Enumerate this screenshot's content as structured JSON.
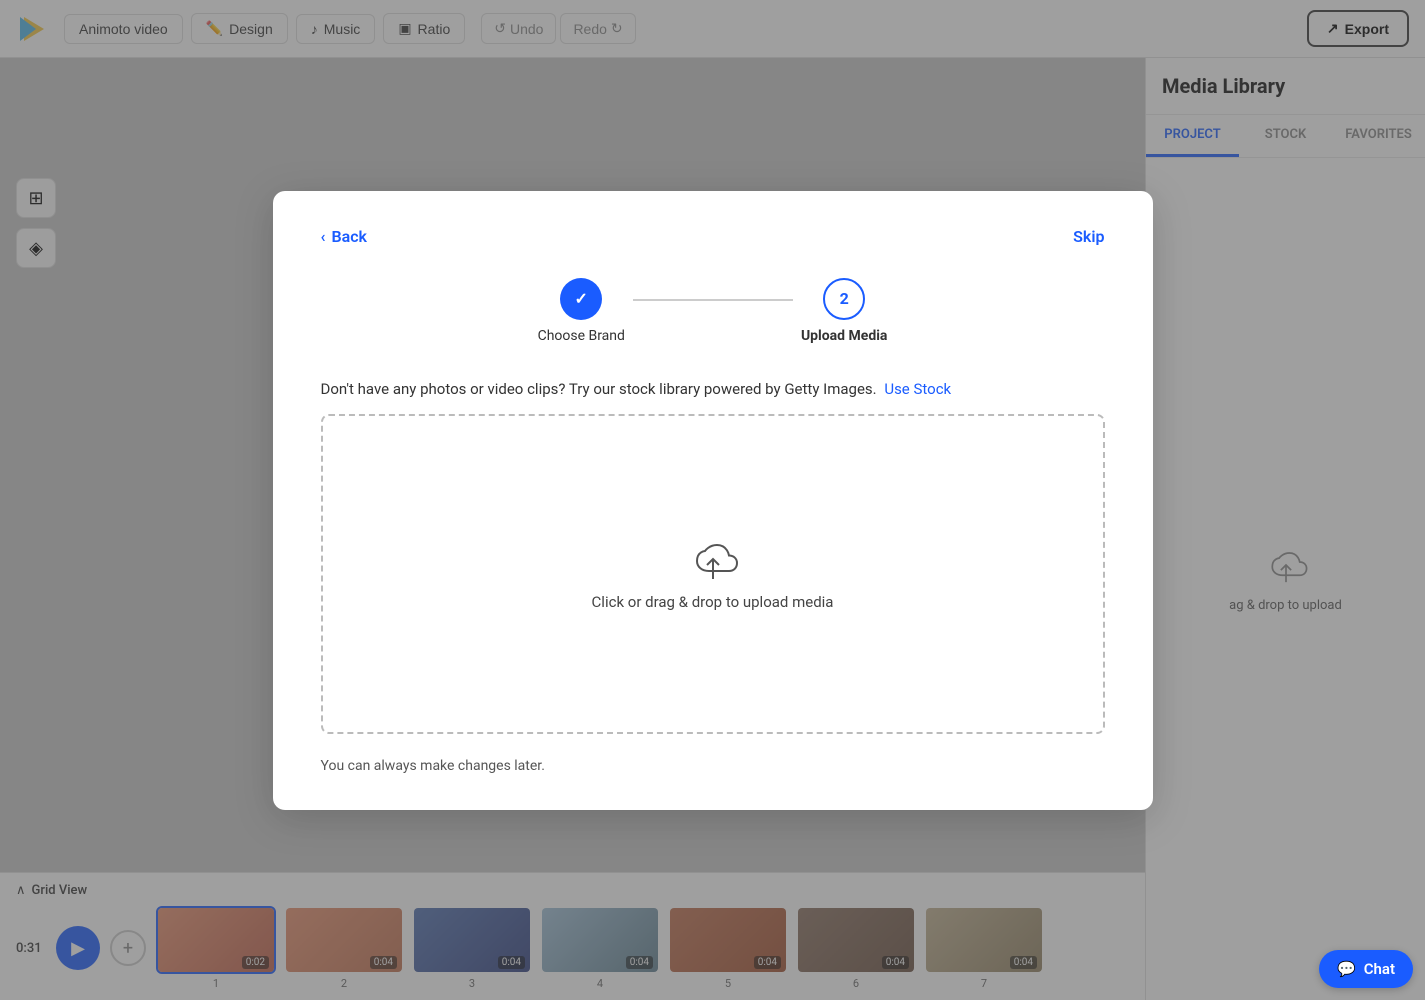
{
  "toolbar": {
    "logo_alt": "Animoto logo",
    "project_label": "Animoto video",
    "design_label": "Design",
    "music_label": "Music",
    "ratio_label": "Ratio",
    "undo_label": "Undo",
    "redo_label": "Redo",
    "export_label": "Export"
  },
  "right_panel": {
    "title": "Media Library",
    "tabs": [
      "PROJECT",
      "STOCK",
      "FAVORITES"
    ],
    "active_tab": 0,
    "upload_text": "ag & drop to upload"
  },
  "bottom": {
    "grid_view_label": "Grid View",
    "time": "0:31",
    "clips": [
      {
        "num": "1",
        "duration": "0:02",
        "selected": true,
        "thumb_class": "thumb-1"
      },
      {
        "num": "2",
        "duration": "0:04",
        "selected": false,
        "thumb_class": "thumb-2"
      },
      {
        "num": "3",
        "duration": "0:04",
        "selected": false,
        "thumb_class": "thumb-3"
      },
      {
        "num": "4",
        "duration": "0:04",
        "selected": false,
        "thumb_class": "thumb-4"
      },
      {
        "num": "5",
        "duration": "0:04",
        "selected": false,
        "thumb_class": "thumb-5"
      },
      {
        "num": "6",
        "duration": "0:04",
        "selected": false,
        "thumb_class": "thumb-6"
      },
      {
        "num": "7",
        "duration": "0:04",
        "selected": false,
        "thumb_class": "thumb-7"
      }
    ]
  },
  "modal": {
    "back_label": "Back",
    "skip_label": "Skip",
    "step1_label": "Choose Brand",
    "step2_label": "Upload Media",
    "step2_num": "2",
    "upload_desc_text": "Don't have any photos or video clips? Try our stock library powered by Getty Images.",
    "use_stock_label": "Use Stock",
    "drop_label": "Click or drag & drop to upload media",
    "footer_note": "You can always make changes later."
  },
  "chat": {
    "label": "Chat"
  }
}
